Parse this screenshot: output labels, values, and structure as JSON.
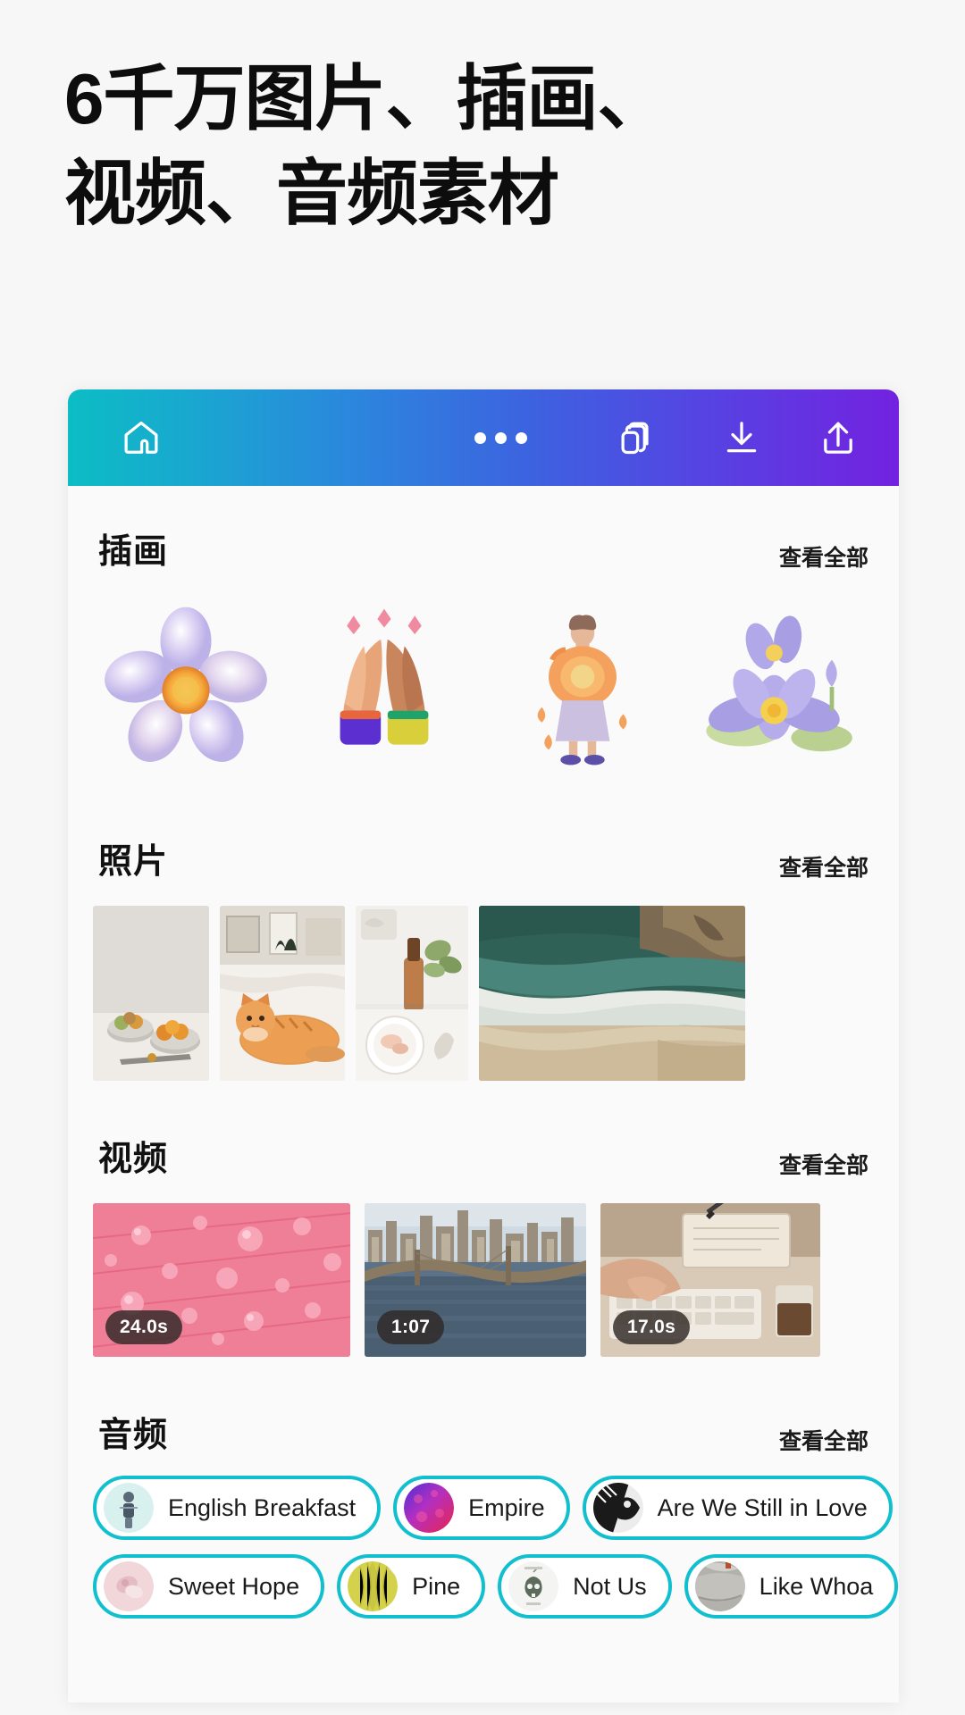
{
  "headline": {
    "line1": "6千万图片、插画、",
    "line2": "视频、音频素材"
  },
  "appbar": {
    "home_label": "home-icon",
    "more_label": "more-icon",
    "duplicate_label": "duplicate-icon",
    "download_label": "download-icon",
    "share_label": "share-icon"
  },
  "sections": {
    "illustrations": {
      "title": "插画",
      "more": "查看全部",
      "items": [
        {
          "name": "iridescent-flower-illustration"
        },
        {
          "name": "praying-hands-illustration"
        },
        {
          "name": "flower-girl-illustration"
        },
        {
          "name": "purple-water-lily-illustration"
        }
      ]
    },
    "photos": {
      "title": "照片",
      "more": "查看全部",
      "items": [
        {
          "name": "fruit-bowls-photo"
        },
        {
          "name": "orange-cat-on-bed-photo"
        },
        {
          "name": "serum-bottle-flatlay-photo"
        },
        {
          "name": "ocean-coast-photo"
        }
      ]
    },
    "videos": {
      "title": "视频",
      "more": "查看全部",
      "items": [
        {
          "name": "pink-water-drops-video",
          "duration": "24.0s"
        },
        {
          "name": "city-skyline-bridge-video",
          "duration": "1:07"
        },
        {
          "name": "typing-keyboard-video",
          "duration": "17.0s"
        }
      ]
    },
    "audio": {
      "title": "音频",
      "more": "查看全部",
      "row1": [
        {
          "label": "English Breakfast",
          "art": "mint-figure-art"
        },
        {
          "label": "Empire",
          "art": "pink-purple-gradient-art"
        },
        {
          "label": "Are We Still in Love",
          "art": "black-white-collage-art"
        }
      ],
      "row2": [
        {
          "label": "Sweet Hope",
          "art": "pink-pastel-art"
        },
        {
          "label": "Pine",
          "art": "yellow-green-texture-art"
        },
        {
          "label": "Not Us",
          "art": "white-skull-art"
        },
        {
          "label": "Like Whoa",
          "art": "grey-stone-art"
        }
      ]
    }
  },
  "colors": {
    "gradient_start": "#0cbdc4",
    "gradient_mid": "#3d62e0",
    "gradient_end": "#7322e0",
    "chip_border": "#12bfcf",
    "page_bg": "#f7f7f7",
    "panel_bg": "#fafafa"
  }
}
